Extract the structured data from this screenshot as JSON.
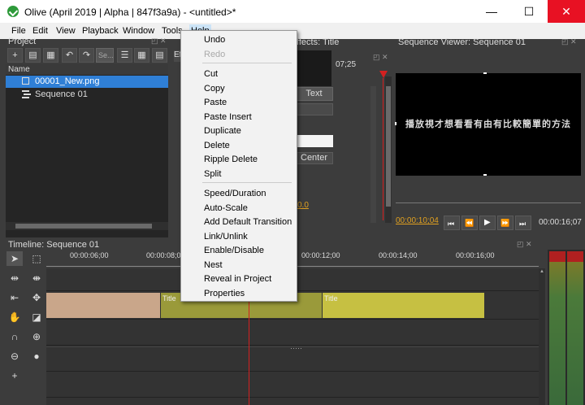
{
  "window": {
    "title": "Olive (April 2019 | Alpha | 847f3a9a) - <untitled>*",
    "minimize": "—",
    "maximize": "☐",
    "close": "✕"
  },
  "menubar": [
    "File",
    "Edit",
    "View",
    "Playback",
    "Window",
    "Tools",
    "Help"
  ],
  "project": {
    "title": "Project",
    "search_placeholder": "Se...",
    "column_name": "Name",
    "items": [
      "00001_New.png",
      "Sequence 01"
    ]
  },
  "effects": {
    "title_suffix": "ffects: Title",
    "tab_label": "Ef",
    "time": "07;25",
    "text_button": "Text",
    "center_button": "Center",
    "value_link": "0.0"
  },
  "viewer": {
    "title": "Sequence Viewer: Sequence 01",
    "subtitle_text": "播放視才想看看有由有比較簡單的方法",
    "current_time": "00:00:10;04",
    "end_time": "00:00:16;07"
  },
  "timeline": {
    "title": "Timeline: Sequence 01",
    "ruler": [
      "00:00:06;00",
      "00:00:08;0",
      "00:00:12;00",
      "00:00:14;00",
      "00:00:16;00"
    ],
    "clips": [
      "Title",
      "Title"
    ]
  },
  "context_menu": {
    "items": [
      "Undo",
      "Redo",
      "Cut",
      "Copy",
      "Paste",
      "Paste Insert",
      "Duplicate",
      "Delete",
      "Ripple Delete",
      "Split",
      "Speed/Duration",
      "Auto-Scale",
      "Add Default Transition",
      "Link/Unlink",
      "Enable/Disable",
      "Nest",
      "Reveal in Project",
      "Properties"
    ]
  },
  "colors": {
    "selection": "#2f7fd6",
    "playhead": "#d42020",
    "clip_image": "#c9a68a",
    "clip_title_a": "#9a9a3a",
    "clip_title_b": "#c6c042",
    "timecode": "#e0a020"
  }
}
